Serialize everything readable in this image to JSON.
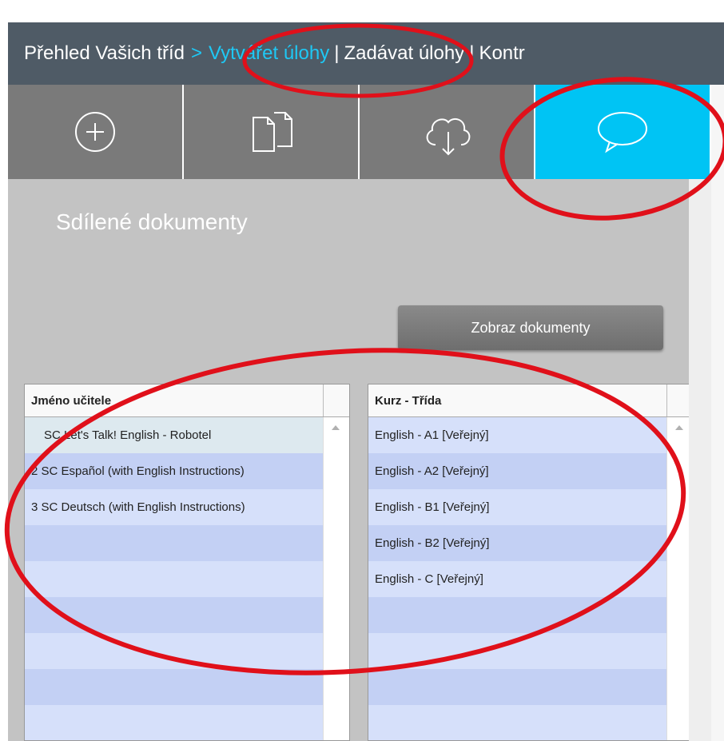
{
  "nav": {
    "overview": "Přehled Vašich tříd",
    "arrow": ">",
    "create": "Vytvářet úlohy",
    "sep1": "|",
    "assign": "Zadávat úlohy",
    "sep2": "|",
    "check": "Kontr"
  },
  "toolbar": {
    "buttons": [
      {
        "icon": "plus-circle-icon",
        "active": false
      },
      {
        "icon": "documents-icon",
        "active": false
      },
      {
        "icon": "cloud-download-icon",
        "active": false
      },
      {
        "icon": "speech-bubble-icon",
        "active": true
      }
    ]
  },
  "section": {
    "title": "Sdílené dokumenty",
    "show_button": "Zobraz dokumenty"
  },
  "teachers_table": {
    "header": "Jméno učitele",
    "rows": [
      "SC Let's Talk! English - Robotel",
      "2 SC Español (with English Instructions)",
      "3 SC Deutsch (with English Instructions)",
      "",
      "",
      "",
      "",
      "",
      ""
    ]
  },
  "courses_table": {
    "header": "Kurz - Třída",
    "rows": [
      "English - A1 [Veřejný]",
      "English - A2 [Veřejný]",
      "English - B1 [Veřejný]",
      "English - B2 [Veřejný]",
      "English - C [Veřejný]",
      "",
      "",
      "",
      ""
    ]
  },
  "colors": {
    "nav_bg": "#4f5b66",
    "nav_active": "#1ec8f5",
    "active_tool": "#00c4f4",
    "annotation": "#e0101a"
  }
}
